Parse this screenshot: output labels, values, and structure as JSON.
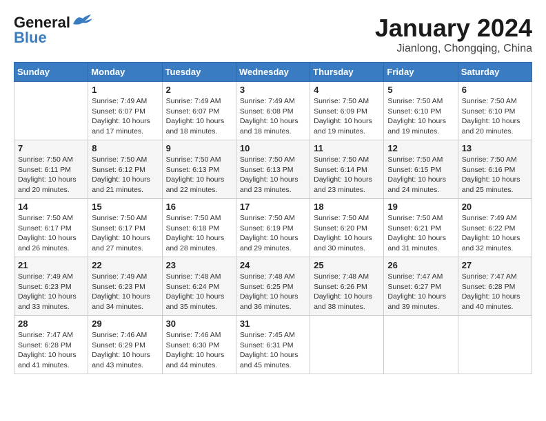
{
  "header": {
    "logo_line1": "General",
    "logo_line2": "Blue",
    "month": "January 2024",
    "location": "Jianlong, Chongqing, China"
  },
  "weekdays": [
    "Sunday",
    "Monday",
    "Tuesday",
    "Wednesday",
    "Thursday",
    "Friday",
    "Saturday"
  ],
  "weeks": [
    [
      {
        "day": "",
        "info": ""
      },
      {
        "day": "1",
        "info": "Sunrise: 7:49 AM\nSunset: 6:07 PM\nDaylight: 10 hours\nand 17 minutes."
      },
      {
        "day": "2",
        "info": "Sunrise: 7:49 AM\nSunset: 6:07 PM\nDaylight: 10 hours\nand 18 minutes."
      },
      {
        "day": "3",
        "info": "Sunrise: 7:49 AM\nSunset: 6:08 PM\nDaylight: 10 hours\nand 18 minutes."
      },
      {
        "day": "4",
        "info": "Sunrise: 7:50 AM\nSunset: 6:09 PM\nDaylight: 10 hours\nand 19 minutes."
      },
      {
        "day": "5",
        "info": "Sunrise: 7:50 AM\nSunset: 6:10 PM\nDaylight: 10 hours\nand 19 minutes."
      },
      {
        "day": "6",
        "info": "Sunrise: 7:50 AM\nSunset: 6:10 PM\nDaylight: 10 hours\nand 20 minutes."
      }
    ],
    [
      {
        "day": "7",
        "info": "Sunrise: 7:50 AM\nSunset: 6:11 PM\nDaylight: 10 hours\nand 20 minutes."
      },
      {
        "day": "8",
        "info": "Sunrise: 7:50 AM\nSunset: 6:12 PM\nDaylight: 10 hours\nand 21 minutes."
      },
      {
        "day": "9",
        "info": "Sunrise: 7:50 AM\nSunset: 6:13 PM\nDaylight: 10 hours\nand 22 minutes."
      },
      {
        "day": "10",
        "info": "Sunrise: 7:50 AM\nSunset: 6:13 PM\nDaylight: 10 hours\nand 23 minutes."
      },
      {
        "day": "11",
        "info": "Sunrise: 7:50 AM\nSunset: 6:14 PM\nDaylight: 10 hours\nand 23 minutes."
      },
      {
        "day": "12",
        "info": "Sunrise: 7:50 AM\nSunset: 6:15 PM\nDaylight: 10 hours\nand 24 minutes."
      },
      {
        "day": "13",
        "info": "Sunrise: 7:50 AM\nSunset: 6:16 PM\nDaylight: 10 hours\nand 25 minutes."
      }
    ],
    [
      {
        "day": "14",
        "info": "Sunrise: 7:50 AM\nSunset: 6:17 PM\nDaylight: 10 hours\nand 26 minutes."
      },
      {
        "day": "15",
        "info": "Sunrise: 7:50 AM\nSunset: 6:17 PM\nDaylight: 10 hours\nand 27 minutes."
      },
      {
        "day": "16",
        "info": "Sunrise: 7:50 AM\nSunset: 6:18 PM\nDaylight: 10 hours\nand 28 minutes."
      },
      {
        "day": "17",
        "info": "Sunrise: 7:50 AM\nSunset: 6:19 PM\nDaylight: 10 hours\nand 29 minutes."
      },
      {
        "day": "18",
        "info": "Sunrise: 7:50 AM\nSunset: 6:20 PM\nDaylight: 10 hours\nand 30 minutes."
      },
      {
        "day": "19",
        "info": "Sunrise: 7:50 AM\nSunset: 6:21 PM\nDaylight: 10 hours\nand 31 minutes."
      },
      {
        "day": "20",
        "info": "Sunrise: 7:49 AM\nSunset: 6:22 PM\nDaylight: 10 hours\nand 32 minutes."
      }
    ],
    [
      {
        "day": "21",
        "info": "Sunrise: 7:49 AM\nSunset: 6:23 PM\nDaylight: 10 hours\nand 33 minutes."
      },
      {
        "day": "22",
        "info": "Sunrise: 7:49 AM\nSunset: 6:23 PM\nDaylight: 10 hours\nand 34 minutes."
      },
      {
        "day": "23",
        "info": "Sunrise: 7:48 AM\nSunset: 6:24 PM\nDaylight: 10 hours\nand 35 minutes."
      },
      {
        "day": "24",
        "info": "Sunrise: 7:48 AM\nSunset: 6:25 PM\nDaylight: 10 hours\nand 36 minutes."
      },
      {
        "day": "25",
        "info": "Sunrise: 7:48 AM\nSunset: 6:26 PM\nDaylight: 10 hours\nand 38 minutes."
      },
      {
        "day": "26",
        "info": "Sunrise: 7:47 AM\nSunset: 6:27 PM\nDaylight: 10 hours\nand 39 minutes."
      },
      {
        "day": "27",
        "info": "Sunrise: 7:47 AM\nSunset: 6:28 PM\nDaylight: 10 hours\nand 40 minutes."
      }
    ],
    [
      {
        "day": "28",
        "info": "Sunrise: 7:47 AM\nSunset: 6:28 PM\nDaylight: 10 hours\nand 41 minutes."
      },
      {
        "day": "29",
        "info": "Sunrise: 7:46 AM\nSunset: 6:29 PM\nDaylight: 10 hours\nand 43 minutes."
      },
      {
        "day": "30",
        "info": "Sunrise: 7:46 AM\nSunset: 6:30 PM\nDaylight: 10 hours\nand 44 minutes."
      },
      {
        "day": "31",
        "info": "Sunrise: 7:45 AM\nSunset: 6:31 PM\nDaylight: 10 hours\nand 45 minutes."
      },
      {
        "day": "",
        "info": ""
      },
      {
        "day": "",
        "info": ""
      },
      {
        "day": "",
        "info": ""
      }
    ]
  ]
}
